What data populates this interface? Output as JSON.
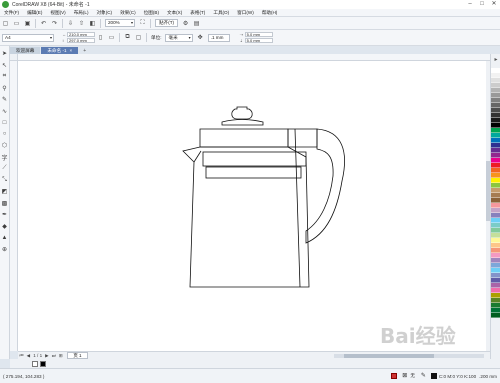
{
  "window": {
    "title": "CorelDRAW X8 (64-Bit) - 未命名 -1",
    "controls": [
      "minimize-icon",
      "maximize-icon",
      "close-icon"
    ]
  },
  "menu": [
    "文件(F)",
    "编辑(E)",
    "视图(V)",
    "布局(L)",
    "对象(C)",
    "效果(C)",
    "位图(B)",
    "文本(X)",
    "表格(T)",
    "工具(O)",
    "窗口(W)",
    "帮助(H)"
  ],
  "toolbar": {
    "zoom": "200%",
    "snap_label": "贴齐(T)",
    "icons": [
      "new-icon",
      "open-icon",
      "save-icon",
      "undo-icon",
      "redo-icon",
      "import-icon",
      "export-icon",
      "publish-pdf-icon",
      "full-screen-icon",
      "settings-icon"
    ]
  },
  "propertybar": {
    "page_size": "A4",
    "width": "210.0 mm",
    "height": "297.0 mm",
    "units_label": "单位:",
    "units": "毫米",
    "nudge": ".1 mm",
    "dup_x": "5.0 mm",
    "dup_y": "5.0 mm"
  },
  "tabs": [
    {
      "label": "欢迎屏幕",
      "active": false
    },
    {
      "label": "未命名 -1",
      "active": true
    }
  ],
  "tools": [
    "pick-tool-icon",
    "shape-tool-icon",
    "crop-tool-icon",
    "zoom-tool-icon",
    "freehand-tool-icon",
    "artistic-media-icon",
    "rectangle-tool-icon",
    "ellipse-tool-icon",
    "polygon-tool-icon",
    "text-tool-icon",
    "parallel-dimension-icon",
    "connector-tool-icon",
    "drop-shadow-icon",
    "transparency-icon",
    "eyedropper-icon",
    "interactive-fill-icon",
    "smart-fill-icon",
    "add-tool-icon"
  ],
  "palette": {
    "colors": [
      "#ffffff",
      "#f2f2f2",
      "#e0e0e0",
      "#cccccc",
      "#b3b3b3",
      "#999999",
      "#808080",
      "#666666",
      "#4d4d4d",
      "#333333",
      "#1a1a1a",
      "#000000",
      "#00a651",
      "#00a99d",
      "#0072bc",
      "#2e3192",
      "#662d91",
      "#92278f",
      "#ec008c",
      "#ed1c24",
      "#f26522",
      "#f7941d",
      "#fff200",
      "#8dc63f",
      "#c69c6d",
      "#a67c52",
      "#8c6239",
      "#f5989d",
      "#c4a3c7",
      "#8781bd",
      "#6dcff6",
      "#7accc8",
      "#82ca9c",
      "#c4df9b",
      "#fff799",
      "#fdc689",
      "#f69679",
      "#f49ac2",
      "#a186be",
      "#7da7d9",
      "#6ecff6",
      "#8393ca",
      "#605ca8",
      "#a864a8",
      "#f06eaa",
      "#aba000",
      "#598527",
      "#1a7b30",
      "#007236",
      "#005e20"
    ]
  },
  "pagenav": {
    "counter": "1 / 1",
    "page_tab": "页 1"
  },
  "status": {
    "coords": "( 275.194, 104.283 )",
    "fill_none": "无",
    "color_info": "C:0 M:0 Y:0 K:100",
    "outline_width": ".200 mm"
  },
  "watermark": "Bai经验"
}
